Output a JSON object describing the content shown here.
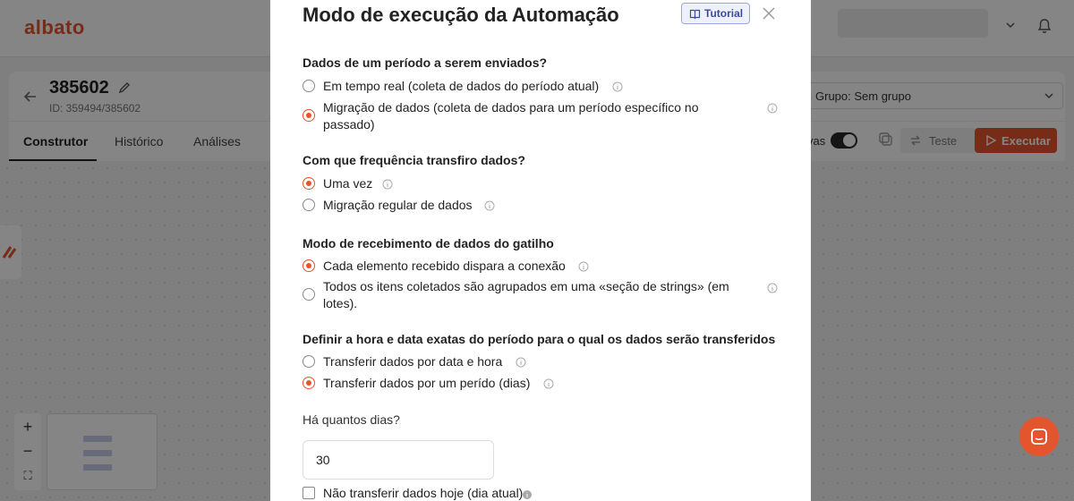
{
  "app": {
    "logo": "albato",
    "automation": {
      "title": "385602",
      "id_text": "ID: 359494/385602"
    },
    "tabs": [
      {
        "label": "Construtor",
        "active": true
      },
      {
        "label": "Histórico",
        "active": false
      },
      {
        "label": "Análises",
        "active": false
      }
    ],
    "group_select": "Grupo: Sem grupo",
    "toggle_label": "vas",
    "test_label": "Teste",
    "run_label": "Executar",
    "zoom_in": "+",
    "zoom_out": "−",
    "fit": "⛶",
    "accent_color": "#e4552d"
  },
  "modal": {
    "title": "Modo de execução da Automação",
    "tutorial_label": "Tutorial",
    "sections": [
      {
        "title": "Dados de um período a serem enviados?",
        "options": [
          {
            "label": "Em tempo real (coleta de dados do período atual)",
            "selected": false
          },
          {
            "label": "Migração de dados (coleta de dados para um período específico no passado)",
            "selected": true
          }
        ]
      },
      {
        "title": "Com que frequência transfiro dados?",
        "options": [
          {
            "label": "Uma vez",
            "selected": true
          },
          {
            "label": "Migração regular de dados",
            "selected": false
          }
        ]
      },
      {
        "title": "Modo de recebimento de dados do gatilho",
        "options": [
          {
            "label": "Cada elemento recebido dispara a conexão",
            "selected": true
          },
          {
            "label": "Todos os itens coletados são agrupados em uma «seção de strings» (em lotes).",
            "selected": false
          }
        ]
      },
      {
        "title": "Definir a hora e data exatas do período para o qual os dados serão transferidos",
        "options": [
          {
            "label": "Transferir dados por data e hora",
            "selected": false
          },
          {
            "label": "Transferir dados por um perído (dias)",
            "selected": true
          }
        ]
      }
    ],
    "days_label": "Há quantos dias?",
    "days_value": "30",
    "exclude_today_label": "Não transferir dados hoje (dia atual)",
    "exclude_today_checked": false
  }
}
